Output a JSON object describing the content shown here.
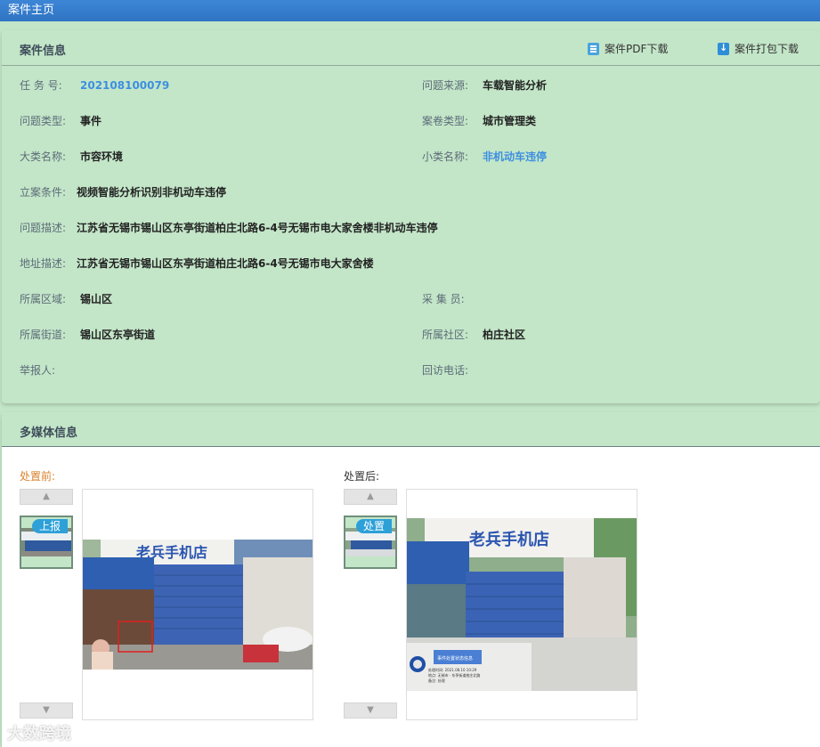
{
  "window": {
    "title": "案件主页"
  },
  "case_info": {
    "title": "案件信息",
    "pdf_download": "案件PDF下载",
    "pack_download": "案件打包下载",
    "fields": [
      {
        "label": "任 务 号:",
        "value": "202108100079"
      },
      {
        "label": "问题来源:",
        "value": "车载智能分析"
      },
      {
        "label": "问题类型:",
        "value": "事件"
      },
      {
        "label": "案卷类型:",
        "value": "城市管理类"
      },
      {
        "label": "大类名称:",
        "value": "市容环境"
      },
      {
        "label": "小类名称:",
        "value": "非机动车违停"
      },
      {
        "label": "立案条件:",
        "value": "视频智能分析识别非机动车违停"
      },
      {
        "label": "问题描述:",
        "value": "江苏省无锡市锡山区东亭街道柏庄北路6-4号无锡市电大家舍楼非机动车违停"
      },
      {
        "label": "地址描述:",
        "value": "江苏省无锡市锡山区东亭街道柏庄北路6-4号无锡市电大家舍楼"
      },
      {
        "label": "所属区域:",
        "value": "锡山区"
      },
      {
        "label": "采 集 员:",
        "value": ""
      },
      {
        "label": "所属街道:",
        "value": "锡山区东亭街道"
      },
      {
        "label": "所属社区:",
        "value": "柏庄社区"
      },
      {
        "label": "举报人:",
        "value": ""
      },
      {
        "label": "回访电话:",
        "value": ""
      }
    ]
  },
  "media": {
    "title": "多媒体信息",
    "before_label": "处置前:",
    "after_label": "处置后:",
    "before_tag": "上报",
    "after_tag": "处置",
    "up_arrow": "▲",
    "down_arrow": "▼",
    "shop_sign": "老兵手机店",
    "overlay_box": "事件处置状态信息",
    "overlay_lines": [
      "处理时间: 2021.08.10 10:29",
      "地点: 无锡市 · 东亭街道柏庄北路",
      "备注: 处理"
    ]
  },
  "watermark": "大数跨境",
  "colors": {
    "accent": "#2f74c3",
    "link": "#3d8fe0",
    "before": "#d9822b",
    "panel": "#c3e6c8"
  }
}
